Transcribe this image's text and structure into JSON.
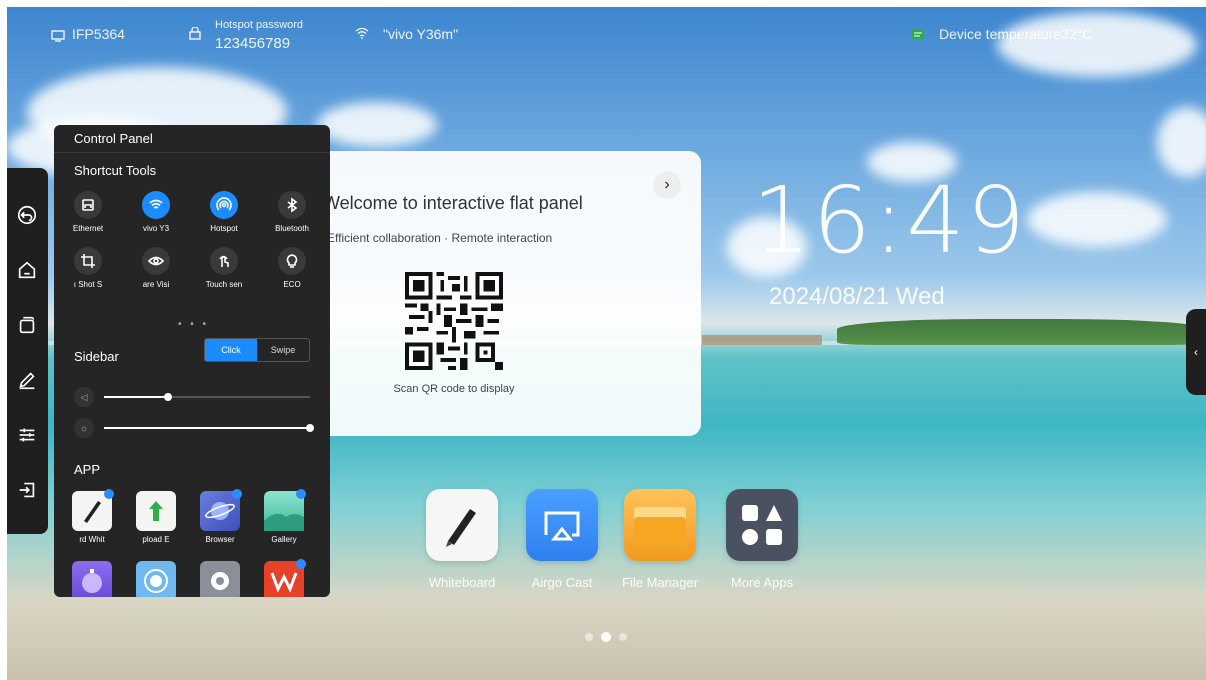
{
  "status_bar": {
    "device_name": "IFP5364",
    "hotspot_label": "Hotspot password",
    "hotspot_password": "123456789",
    "wifi_name": "\"vivo Y36m\"",
    "temperature": "Device temperature32°C"
  },
  "clock": {
    "time": "16:49",
    "date": "2024/08/21 Wed"
  },
  "sidebar": {
    "items": [
      "back-icon",
      "home-icon",
      "windows-icon",
      "pen-icon",
      "settings-sliders-icon",
      "input-source-icon"
    ]
  },
  "control_panel": {
    "title": "Control Panel",
    "shortcut_title": "Shortcut Tools",
    "tools": [
      {
        "label": "Ethernet",
        "icon": "ethernet-icon",
        "on": false
      },
      {
        "label": "vivo Y3",
        "icon": "wifi-icon",
        "on": true
      },
      {
        "label": "Hotspot",
        "icon": "hotspot-icon",
        "on": true
      },
      {
        "label": "Bluetooth",
        "icon": "bluetooth-icon",
        "on": false
      },
      {
        "label": "ı Shot   S",
        "icon": "crop-icon",
        "on": false
      },
      {
        "label": "are   Visi",
        "icon": "eye-icon",
        "on": false
      },
      {
        "label": "Touch sen",
        "icon": "touch-icon",
        "on": false
      },
      {
        "label": "ECO",
        "icon": "bulb-icon",
        "on": false
      }
    ],
    "sidebar_label": "Sidebar",
    "sidebar_mode": {
      "click": "Click",
      "swipe": "Swipe",
      "selected": "Click"
    },
    "volume_level": 0.31,
    "brightness_level": 1.0,
    "app_title": "APP",
    "apps": [
      {
        "label": "rd   Whit",
        "icon": "whiteboard-icon"
      },
      {
        "label": "pload   E",
        "icon": "upload-icon"
      },
      {
        "label": "Browser",
        "icon": "browser-icon"
      },
      {
        "label": "Gallery",
        "icon": "gallery-icon"
      },
      {
        "label": "",
        "icon": "timer-icon"
      },
      {
        "label": "",
        "icon": "record-icon"
      },
      {
        "label": "",
        "icon": "settings-icon"
      },
      {
        "label": "",
        "icon": "wps-icon"
      }
    ]
  },
  "welcome_card": {
    "title": "Welcome to interactive flat panel",
    "subtitle": "Efficient collaboration · Remote interaction",
    "qr_caption": "Scan QR code to display",
    "next_glyph": "›"
  },
  "dock": [
    {
      "label": "Whiteboard",
      "icon": "whiteboard-icon"
    },
    {
      "label": "Airgo Cast",
      "icon": "cast-icon"
    },
    {
      "label": "File Manager",
      "icon": "folder-icon"
    },
    {
      "label": "More Apps",
      "icon": "more-apps-icon"
    }
  ],
  "pager": {
    "count": 3,
    "active": 1
  },
  "colors": {
    "accent": "#1a8cff",
    "panel": "#252525",
    "sidebar": "#1f1f1f"
  }
}
